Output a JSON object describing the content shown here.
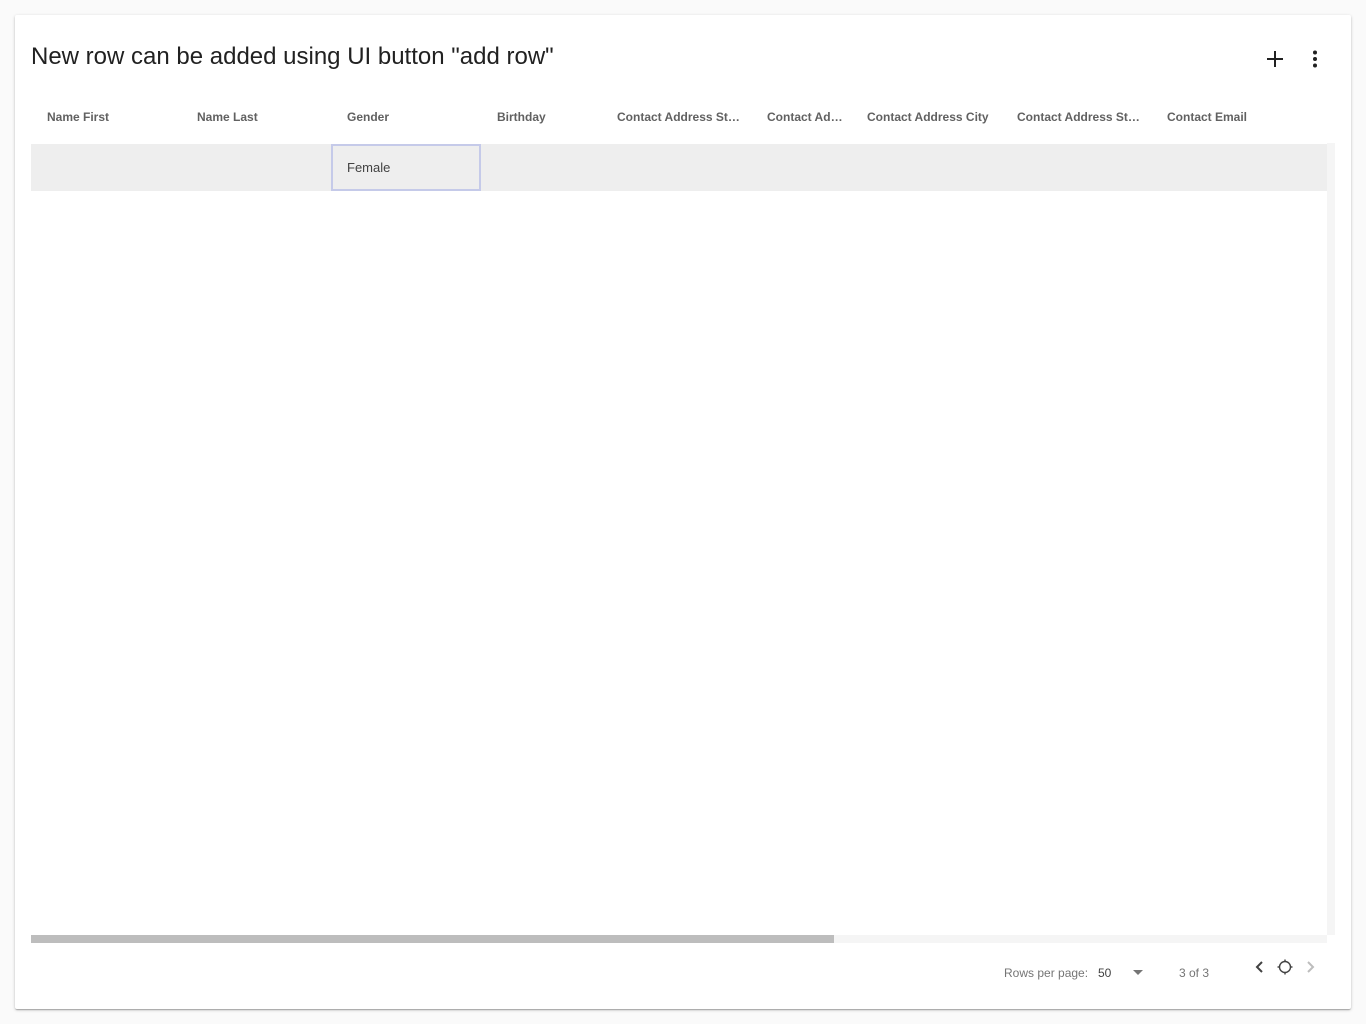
{
  "toolbar": {
    "title": "New row can be added using UI button \"add row\"",
    "add_icon": "plus-icon",
    "more_icon": "more-vert-icon"
  },
  "table": {
    "columns": [
      {
        "label": "Name First"
      },
      {
        "label": "Name Last"
      },
      {
        "label": "Gender"
      },
      {
        "label": "Birthday"
      },
      {
        "label": "Contact Address Street"
      },
      {
        "label": "Contact Address Zip"
      },
      {
        "label": "Contact Address City"
      },
      {
        "label": "Contact Address State"
      },
      {
        "label": "Contact Email"
      }
    ],
    "rows": [
      {
        "cells": [
          "",
          "",
          "Female",
          "",
          "",
          "",
          "",
          "",
          ""
        ]
      }
    ]
  },
  "footer": {
    "rows_per_page_label": "Rows per page:",
    "rows_per_page_value": "50",
    "page_info": "3 of 3",
    "prev_icon": "chevron-left-icon",
    "refresh_icon": "refresh-icon",
    "next_icon": "chevron-right-icon"
  },
  "colors": {
    "selected_row": "#eeeeee",
    "selected_cell_border": "#c5cae9",
    "scroll_thumb": "#bdbdbd"
  }
}
